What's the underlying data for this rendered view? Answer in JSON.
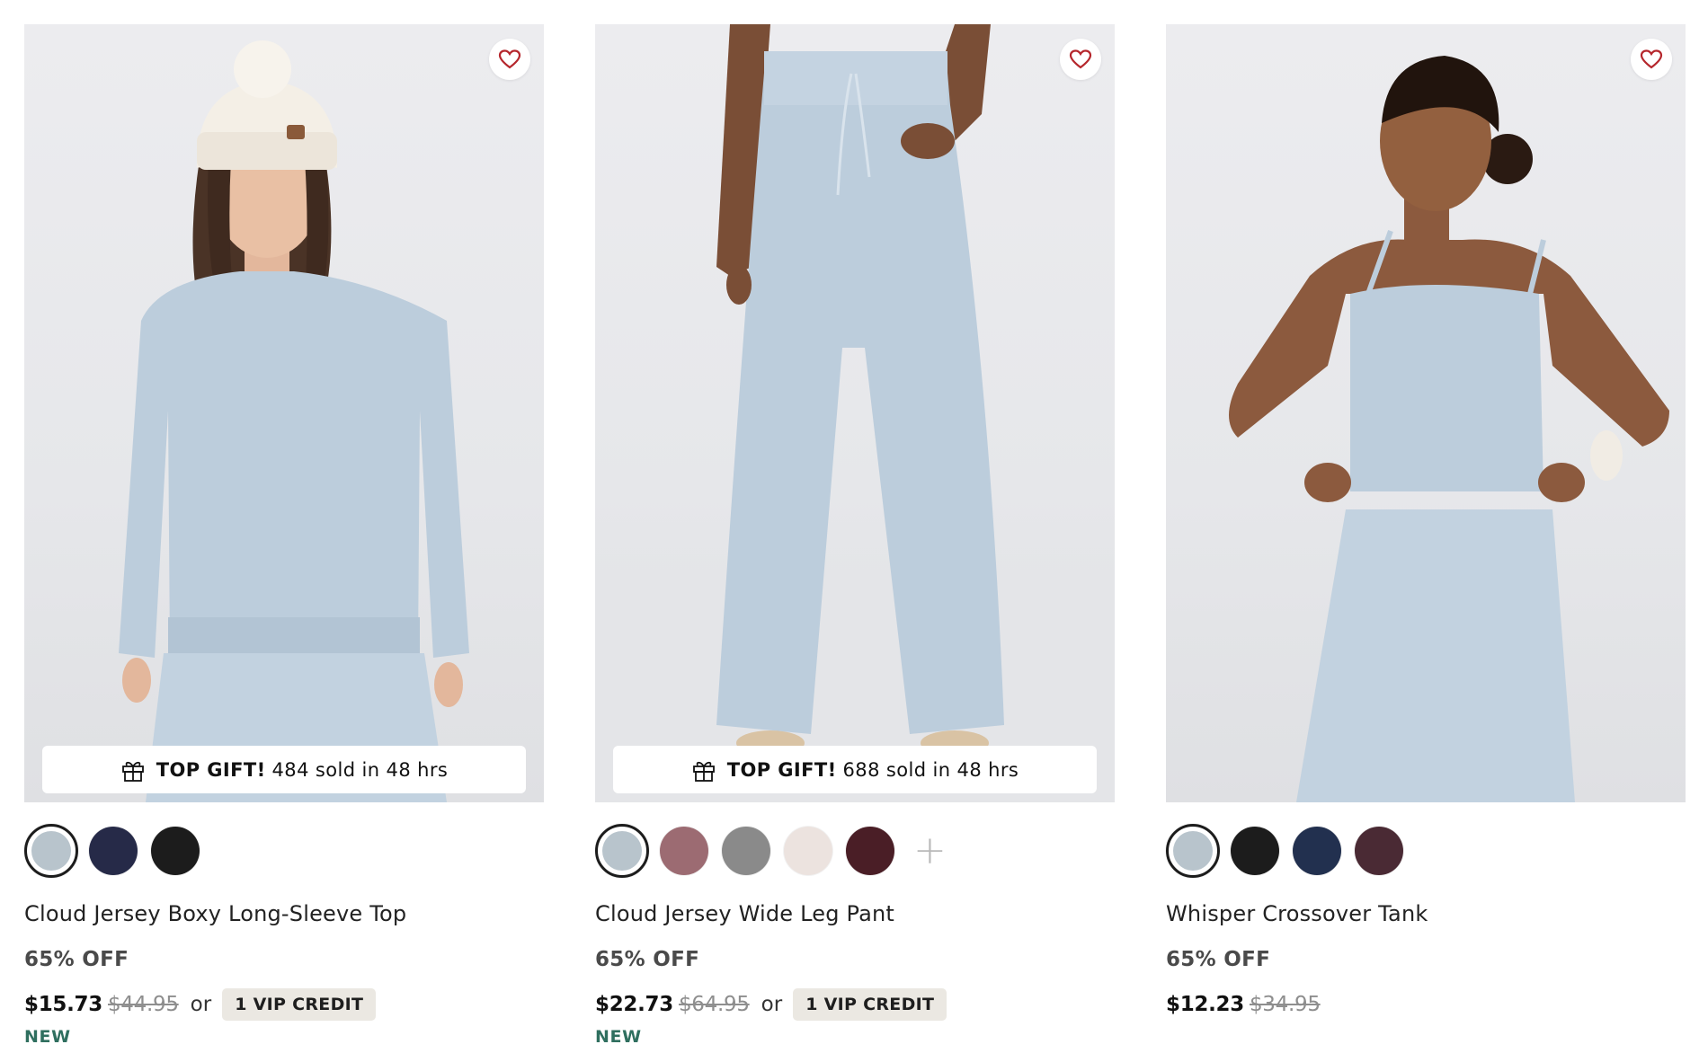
{
  "products": [
    {
      "name": "Cloud Jersey Boxy Long-Sleeve Top",
      "discount": "65% OFF",
      "price": "$15.73",
      "original_price": "$44.95",
      "or_text": "or",
      "vip_credit": "1 VIP CREDIT",
      "tag": "NEW",
      "banner": {
        "strong": "TOP GIFT!",
        "text": "484 sold in 48 hrs"
      },
      "swatches": [
        "#b8c4cc",
        "#262a48",
        "#1c1c1c"
      ],
      "selected_swatch": 0
    },
    {
      "name": "Cloud Jersey Wide Leg Pant",
      "discount": "65% OFF",
      "price": "$22.73",
      "original_price": "$64.95",
      "or_text": "or",
      "vip_credit": "1 VIP CREDIT",
      "tag": "NEW",
      "banner": {
        "strong": "TOP GIFT!",
        "text": "688 sold in 48 hrs"
      },
      "swatches": [
        "#b8c4cc",
        "#9c6b72",
        "#8a8a8a",
        "#ece3df",
        "#4a1e26"
      ],
      "selected_swatch": 0,
      "more_colors": "+"
    },
    {
      "name": "Whisper Crossover Tank",
      "discount": "65% OFF",
      "price": "$12.23",
      "original_price": "$34.95",
      "swatches": [
        "#b8c4cc",
        "#1c1c1c",
        "#22304f",
        "#4a2a34"
      ],
      "selected_swatch": 0
    }
  ],
  "colors": {
    "garment": "#bccddc",
    "heart": "#b5262c",
    "new_tag": "#2f6f5f"
  },
  "icons": {
    "wishlist": "heart-icon",
    "gift": "gift-icon",
    "more": "plus-icon"
  }
}
